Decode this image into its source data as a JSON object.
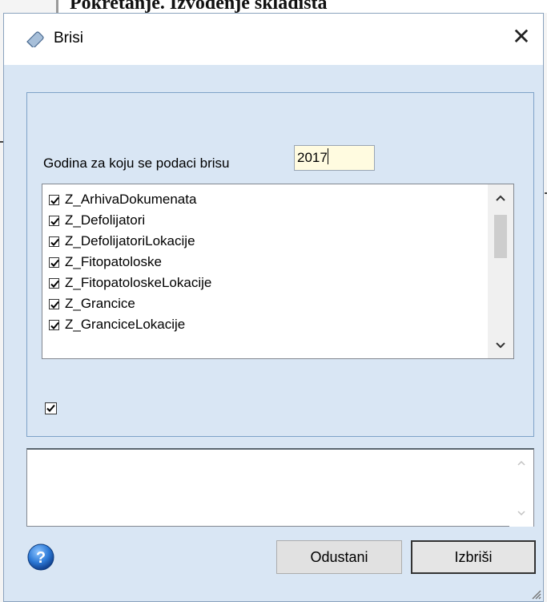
{
  "background": {
    "fragment_text": "Pokretanje. Izvodenje skladista"
  },
  "dialog": {
    "title": "Brisi",
    "title_icon": "eraser-icon",
    "close_glyph": "✕",
    "year_label": "Godina za koju se podaci brisu",
    "year_value": "2017",
    "tables": [
      {
        "label": "Z_ArhivaDokumenata",
        "checked": true
      },
      {
        "label": "Z_Defolijatori",
        "checked": true
      },
      {
        "label": "Z_DefolijatoriLokacije",
        "checked": true
      },
      {
        "label": "Z_Fitopatoloske",
        "checked": true
      },
      {
        "label": "Z_FitopatoloskeLokacije",
        "checked": true
      },
      {
        "label": "Z_Grancice",
        "checked": true
      },
      {
        "label": "Z_GranciceLokacije",
        "checked": true
      }
    ],
    "select_all_checked": true,
    "memo_text": "",
    "cancel_label": "Odustani",
    "delete_label": "Izbriši",
    "help_icon": "help-icon"
  },
  "colors": {
    "client_bg": "#d9e6f4",
    "input_bg": "#fffbe0",
    "help_blue": "#1f6fd1"
  }
}
